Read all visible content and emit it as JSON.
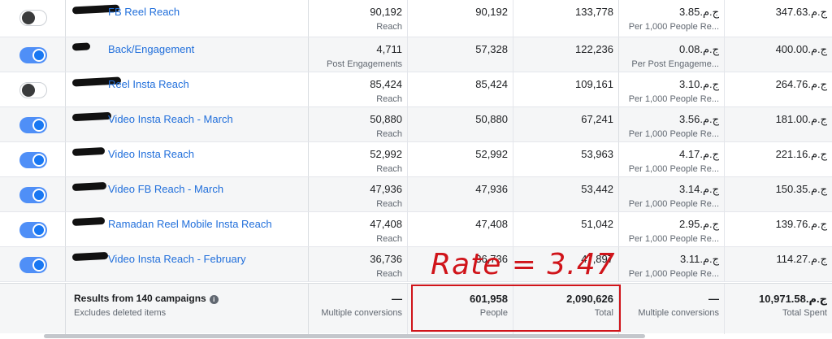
{
  "rows": [
    {
      "toggle": "off",
      "name": "FB Reel Reach",
      "results": "90,192",
      "result_type": "Reach",
      "reach": "90,192",
      "impressions": "133,778",
      "cost": "ج.م.‏3.85",
      "cost_label": "Per 1,000 People Re...",
      "spent": "ج.م.‏347.63"
    },
    {
      "toggle": "on",
      "name": "Back/Engagement",
      "results": "4,711",
      "result_type": "Post Engagements",
      "reach": "57,328",
      "impressions": "122,236",
      "cost": "ج.م.‏0.08",
      "cost_label": "Per Post Engageme...",
      "spent": "ج.م.‏400.00"
    },
    {
      "toggle": "off",
      "name": "Reel Insta Reach",
      "results": "85,424",
      "result_type": "Reach",
      "reach": "85,424",
      "impressions": "109,161",
      "cost": "ج.م.‏3.10",
      "cost_label": "Per 1,000 People Re...",
      "spent": "ج.م.‏264.76"
    },
    {
      "toggle": "on",
      "name": "Video Insta Reach - March",
      "results": "50,880",
      "result_type": "Reach",
      "reach": "50,880",
      "impressions": "67,241",
      "cost": "ج.م.‏3.56",
      "cost_label": "Per 1,000 People Re...",
      "spent": "ج.م.‏181.00"
    },
    {
      "toggle": "on",
      "name": "Video Insta Reach",
      "results": "52,992",
      "result_type": "Reach",
      "reach": "52,992",
      "impressions": "53,963",
      "cost": "ج.م.‏4.17",
      "cost_label": "Per 1,000 People Re...",
      "spent": "ج.م.‏221.16"
    },
    {
      "toggle": "on",
      "name": "Video FB Reach - March",
      "results": "47,936",
      "result_type": "Reach",
      "reach": "47,936",
      "impressions": "53,442",
      "cost": "ج.م.‏3.14",
      "cost_label": "Per 1,000 People Re...",
      "spent": "ج.م.‏150.35"
    },
    {
      "toggle": "on",
      "name": "Ramadan Reel Mobile Insta Reach",
      "results": "47,408",
      "result_type": "Reach",
      "reach": "47,408",
      "impressions": "51,042",
      "cost": "ج.م.‏2.95",
      "cost_label": "Per 1,000 People Re...",
      "spent": "ج.م.‏139.76"
    },
    {
      "toggle": "on",
      "name": "Video Insta Reach - February",
      "results": "36,736",
      "result_type": "Reach",
      "reach": "36,736",
      "impressions": "47,897",
      "cost": "ج.م.‏3.11",
      "cost_label": "Per 1,000 People Re...",
      "spent": "ج.م.‏114.27"
    }
  ],
  "summary": {
    "title": "Results from 140 campaigns",
    "info_icon": "i",
    "subtitle": "Excludes deleted items",
    "results": "—",
    "results_label": "Multiple conversions",
    "reach": "601,958",
    "reach_label": "People",
    "impressions": "2,090,626",
    "impressions_label": "Total",
    "cost": "—",
    "cost_label": "Multiple conversions",
    "spent": "ج.م.‏10,971.58",
    "spent_label": "Total Spent"
  },
  "annotation": {
    "text": "Rate = 3.47",
    "color": "#d0141a"
  },
  "colors": {
    "link": "#216fdb",
    "toggle_on": "#1877f2"
  }
}
